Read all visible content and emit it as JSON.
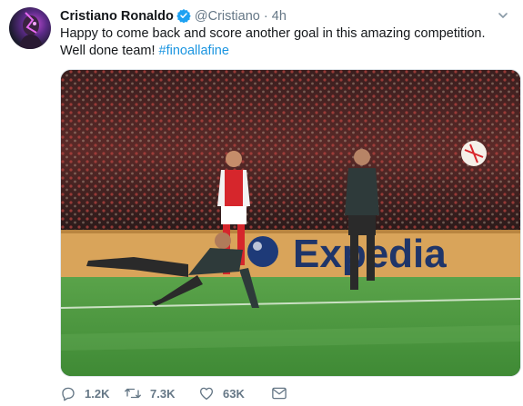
{
  "tweet": {
    "author_name": "Cristiano Ronaldo",
    "handle": "@Cristiano",
    "separator": "·",
    "time": "4h",
    "text_main": "Happy to come back and score another goal in this amazing competition. Well done team! ",
    "hashtag": "#finoallafine",
    "media_sponsor_text": "Expedia",
    "replies": "1.2K",
    "retweets": "7.3K",
    "likes": "63K"
  },
  "colors": {
    "link": "#1b95e0",
    "secondary_text": "#657786",
    "verified_badge": "#1da1f2",
    "border": "#e1e8ed"
  },
  "icons": [
    "verified-icon",
    "chevron-down-icon",
    "reply-icon",
    "retweet-icon",
    "like-icon",
    "message-icon"
  ]
}
